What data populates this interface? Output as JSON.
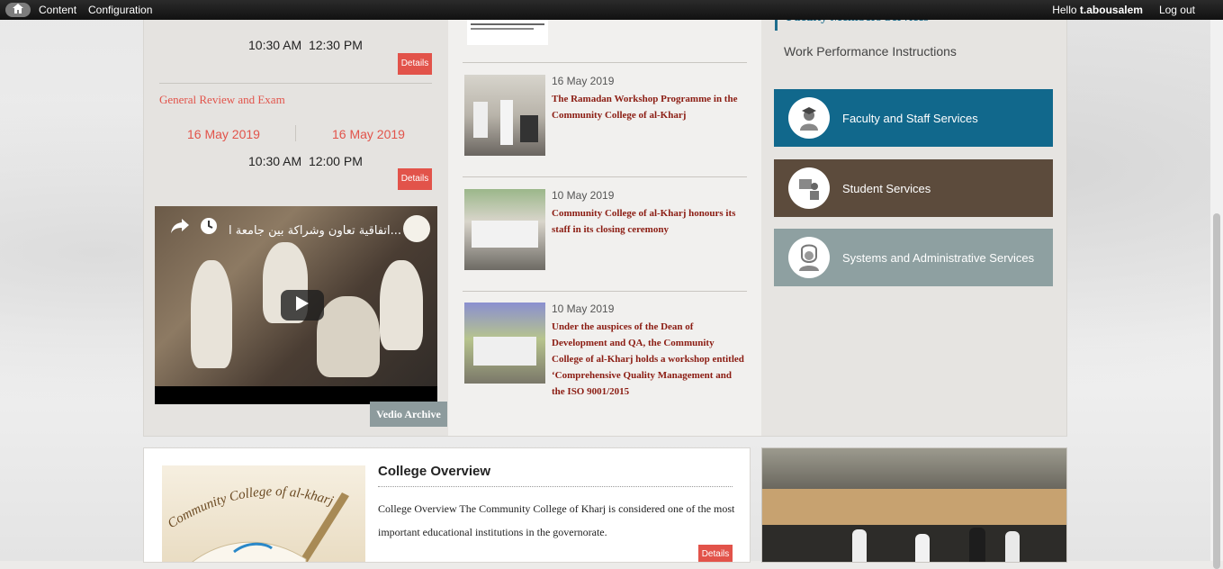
{
  "topbar": {
    "nav": [
      "Content",
      "Configuration"
    ],
    "greeting": "Hello",
    "username": "t.abousalem",
    "logout": "Log out"
  },
  "events": [
    {
      "start_time": "10:30 AM",
      "end_time": "12:30 PM",
      "details": "Details"
    },
    {
      "title": "General Review and Exam",
      "date_from": "16 May 2019",
      "date_to": "16 May 2019",
      "start_time": "10:30 AM",
      "end_time": "12:00 PM",
      "details": "Details"
    }
  ],
  "video": {
    "title_ar": "اتفاقية تعاون وشراكة بين جامعة ا...",
    "archive_button": "Vedio Archive"
  },
  "news": [
    {
      "date": "16 May 2019",
      "title": "The Ramadan Workshop Programme in the Community College of al-Kharj"
    },
    {
      "date": "10 May 2019",
      "title": "Community College of al-Kharj honours its staff in its closing ceremony"
    },
    {
      "date": "10 May 2019",
      "title": "Under the auspices of the Dean of Development and QA, the Community College of al-Kharj holds a workshop entitled ‘Comprehensive Quality Management and the ISO 9001/2015"
    }
  ],
  "services": {
    "heading": "Faculty Members Services",
    "instructions": "Work Performance Instructions",
    "buttons": [
      {
        "label": "Faculty and Staff Services",
        "color": "#11688c"
      },
      {
        "label": "Student Services",
        "color": "#5c4b3c"
      },
      {
        "label": "Systems and Administrative Services",
        "color": "#8ea0a1"
      }
    ]
  },
  "overview": {
    "title": "College Overview",
    "text": "College Overview  The Community College of Kharj is considered one of the most important educational institutions in the governorate.",
    "details": "Details",
    "image_caption": "Community College of al-kharj"
  }
}
